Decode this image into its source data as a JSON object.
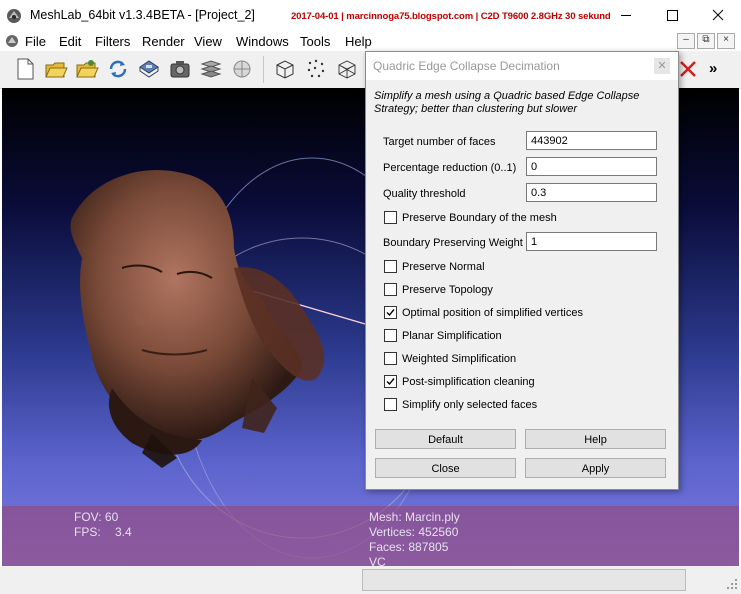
{
  "window": {
    "title": "MeshLab_64bit v1.3.4BETA - [Project_2]",
    "watermark": "2017-04-01 | marcinnoga75.blogspot.com | C2D T9600 2.8GHz 30 sekund",
    "minimize_icon": "minimize-icon",
    "maximize_icon": "maximize-icon",
    "close_icon": "close-icon"
  },
  "menu": {
    "items": [
      "File",
      "Edit",
      "Filters",
      "Render",
      "View",
      "Windows",
      "Tools",
      "Help"
    ]
  },
  "mdi_controls": [
    "–",
    "⧉",
    "×"
  ],
  "toolbar": {
    "icons": [
      "new-project-icon",
      "open-project-icon",
      "open-mesh-icon",
      "reload-icon",
      "save-icon",
      "snapshot-icon",
      "layers-icon",
      "blank-icon",
      "bbox-icon",
      "points-icon",
      "wireframe-icon"
    ],
    "overflow": "»"
  },
  "viewport": {
    "fov_label": "FOV: 60",
    "fps_label": "FPS:",
    "fps_value": "3.4",
    "mesh_label": "Mesh: Marcin.ply",
    "vertices_label": "Vertices: 452560",
    "faces_label": "Faces: 887805",
    "vc_label": "VC"
  },
  "dialog": {
    "title": "Quadric Edge Collapse Decimation",
    "description": "Simplify a mesh using a Quadric based Edge Collapse Strategy; better than clustering but slower",
    "fields": [
      {
        "label": "Target number of faces",
        "value": "443902"
      },
      {
        "label": "Percentage reduction (0..1)",
        "value": "0"
      },
      {
        "label": "Quality threshold",
        "value": "0.3"
      }
    ],
    "preserve_boundary": {
      "label": "Preserve Boundary of the mesh",
      "checked": false
    },
    "boundary_weight": {
      "label": "Boundary Preserving Weight",
      "value": "1"
    },
    "checkboxes": [
      {
        "label": "Preserve Normal",
        "checked": false
      },
      {
        "label": "Preserve Topology",
        "checked": false
      },
      {
        "label": "Optimal position of simplified vertices",
        "checked": true
      },
      {
        "label": "Planar Simplification",
        "checked": false
      },
      {
        "label": "Weighted Simplification",
        "checked": false
      },
      {
        "label": "Post-simplification cleaning",
        "checked": true
      },
      {
        "label": "Simplify only selected faces",
        "checked": false
      }
    ],
    "buttons": {
      "default": "Default",
      "help": "Help",
      "close": "Close",
      "apply": "Apply"
    }
  }
}
